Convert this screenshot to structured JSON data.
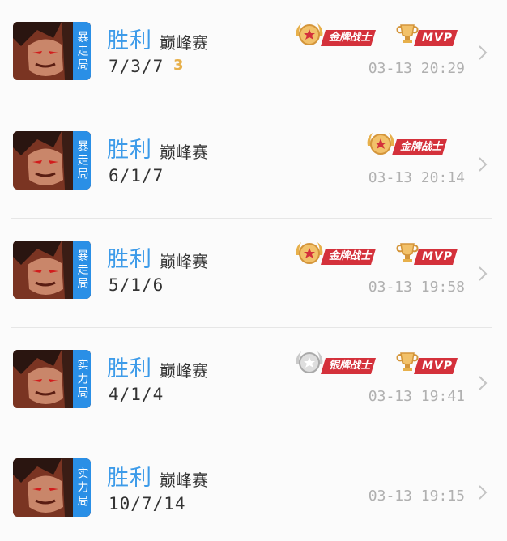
{
  "matches": [
    {
      "mode": "暴走局",
      "result": "胜利",
      "match_type": "巅峰赛",
      "kda": "7/3/7",
      "streak": "3",
      "badges": [
        {
          "kind": "gold-medal",
          "label": "金牌战士"
        },
        {
          "kind": "mvp",
          "label": "MVP"
        }
      ],
      "time": "03-13 20:29"
    },
    {
      "mode": "暴走局",
      "result": "胜利",
      "match_type": "巅峰赛",
      "kda": "6/1/7",
      "badges": [
        {
          "kind": "gold-medal",
          "label": "金牌战士"
        }
      ],
      "time": "03-13 20:14"
    },
    {
      "mode": "暴走局",
      "result": "胜利",
      "match_type": "巅峰赛",
      "kda": "5/1/6",
      "badges": [
        {
          "kind": "gold-medal",
          "label": "金牌战士"
        },
        {
          "kind": "mvp",
          "label": "MVP"
        }
      ],
      "time": "03-13 19:58"
    },
    {
      "mode": "实力局",
      "result": "胜利",
      "match_type": "巅峰赛",
      "kda": "4/1/4",
      "badges": [
        {
          "kind": "silver-medal",
          "label": "银牌战士"
        },
        {
          "kind": "mvp",
          "label": "MVP"
        }
      ],
      "time": "03-13 19:41"
    },
    {
      "mode": "实力局",
      "result": "胜利",
      "match_type": "巅峰赛",
      "kda": "10/7/14",
      "badges": [],
      "time": "03-13 19:15"
    }
  ],
  "colors": {
    "result_blue": "#3d9be9",
    "mode_badge_blue": "#2a8fe6",
    "badge_red": "#d4313b",
    "gold": "#e7b04b",
    "silver": "#c9c9c9"
  },
  "icons": {
    "chevron": "chevron-right-icon",
    "gold_medal": "gold-medal-icon",
    "silver_medal": "silver-medal-icon",
    "mvp_trophy": "trophy-icon"
  }
}
